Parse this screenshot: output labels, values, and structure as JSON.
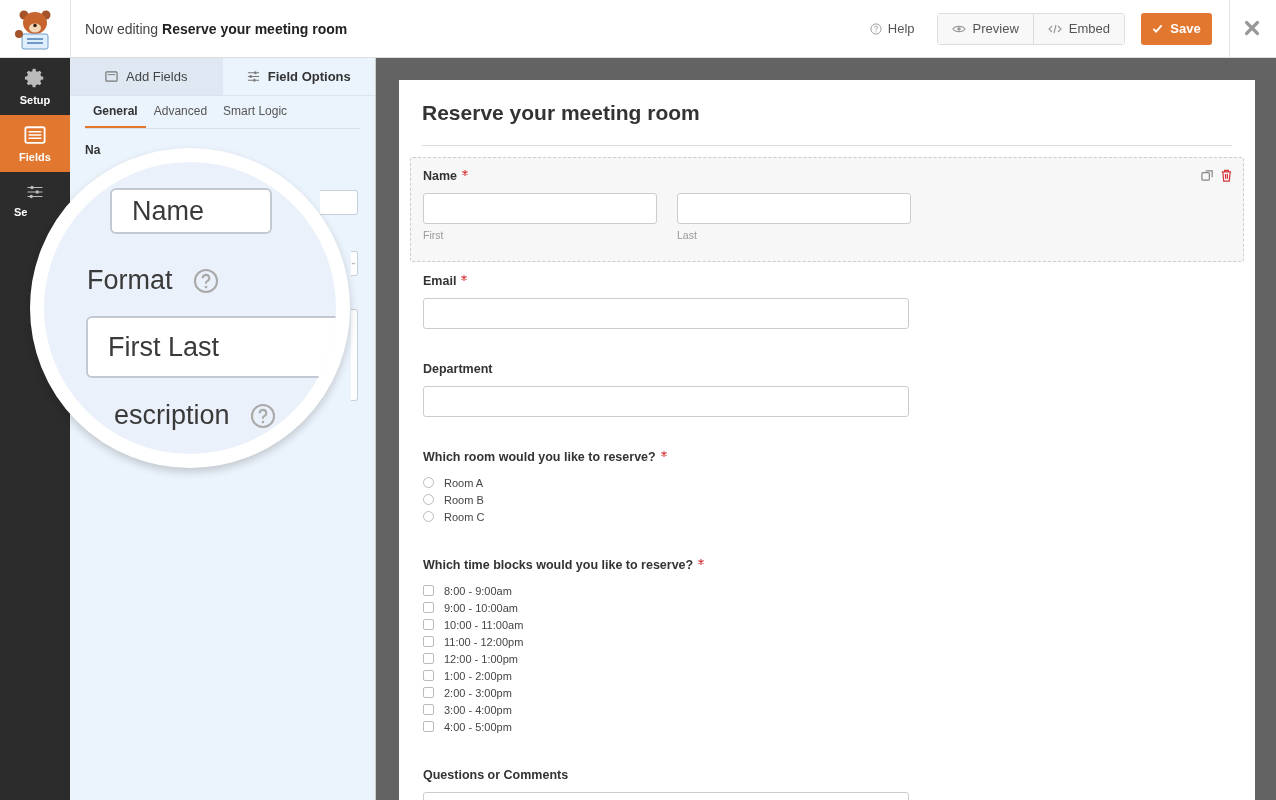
{
  "header": {
    "editing_prefix": "Now editing",
    "form_name": "Reserve your meeting room",
    "help": "Help",
    "preview": "Preview",
    "embed": "Embed",
    "save": "Save"
  },
  "sidebar": {
    "items": [
      {
        "label": "Setup",
        "kind": "gear",
        "selected": false
      },
      {
        "label": "Fields",
        "kind": "fields",
        "selected": true
      },
      {
        "label": "Se",
        "kind": "sliders",
        "selected": false
      }
    ]
  },
  "panel": {
    "tabs": [
      {
        "label": "Add Fields",
        "kind": "add",
        "selected": false
      },
      {
        "label": "Field Options",
        "kind": "options",
        "selected": true
      }
    ],
    "subtabs": [
      {
        "label": "General",
        "selected": true
      },
      {
        "label": "Advanced",
        "selected": false
      },
      {
        "label": "Smart Logic",
        "selected": false
      }
    ],
    "field_label": "Na"
  },
  "magnifier": {
    "label_value": "Name",
    "format_label": "Format",
    "format_value": "First Last",
    "description_label": "escription"
  },
  "form": {
    "title": "Reserve your meeting room",
    "fields": [
      {
        "kind": "name",
        "label": "Name",
        "required": true,
        "selected": true,
        "sublabels": [
          "First",
          "Last"
        ]
      },
      {
        "kind": "text",
        "label": "Email",
        "required": true,
        "selected": false
      },
      {
        "kind": "text",
        "label": "Department",
        "required": false,
        "selected": false
      },
      {
        "kind": "radio",
        "label": "Which room would you like to reserve?",
        "required": true,
        "selected": false,
        "options": [
          {
            "label": "Room A",
            "selected": false
          },
          {
            "label": "Room B",
            "selected": false
          },
          {
            "label": "Room C",
            "selected": false
          }
        ]
      },
      {
        "kind": "checkbox",
        "label": "Which time blocks would you like to reserve?",
        "required": true,
        "selected": false,
        "options": [
          {
            "label": "8:00 - 9:00am",
            "checked": false
          },
          {
            "label": "9:00 - 10:00am",
            "checked": false
          },
          {
            "label": "10:00 - 11:00am",
            "checked": false
          },
          {
            "label": "11:00 - 12:00pm",
            "checked": false
          },
          {
            "label": "12:00 - 1:00pm",
            "checked": false
          },
          {
            "label": "1:00 - 2:00pm",
            "checked": false
          },
          {
            "label": "2:00 - 3:00pm",
            "checked": false
          },
          {
            "label": "3:00 - 4:00pm",
            "checked": false
          },
          {
            "label": "4:00 - 5:00pm",
            "checked": false
          }
        ]
      },
      {
        "kind": "textarea",
        "label": "Questions or Comments",
        "required": false,
        "selected": false
      }
    ]
  }
}
